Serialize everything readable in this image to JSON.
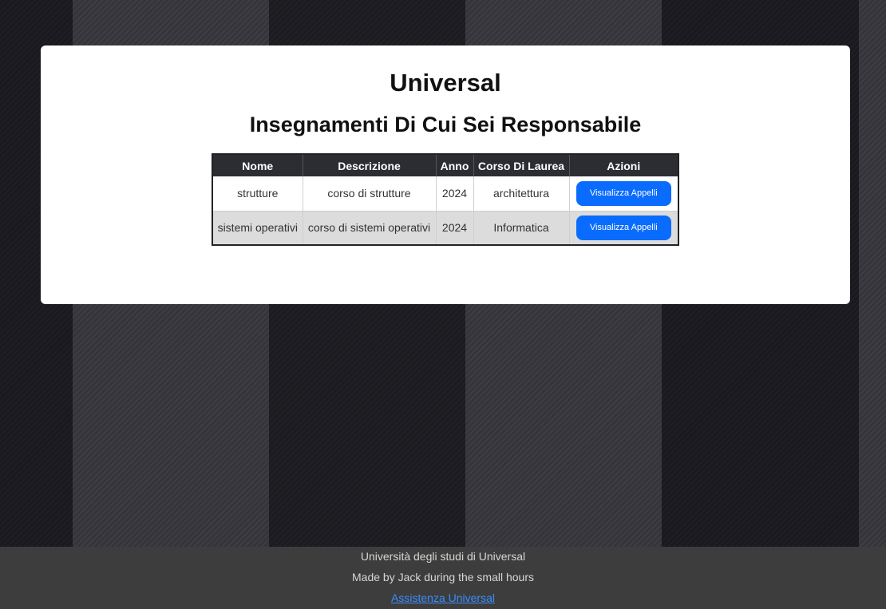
{
  "header": {
    "brand": "Universal",
    "subtitle": "Insegnamenti Di Cui Sei Responsabile"
  },
  "table": {
    "columns": [
      "Nome",
      "Descrizione",
      "Anno",
      "Corso Di Laurea",
      "Azioni"
    ],
    "rows": [
      {
        "nome": "strutture",
        "descrizione": "corso di strutture",
        "anno": "2024",
        "corso": "architettura",
        "azione": "Visualizza Appelli"
      },
      {
        "nome": "sistemi operativi",
        "descrizione": "corso di sistemi operativi",
        "anno": "2024",
        "corso": "Informatica",
        "azione": "Visualizza Appelli"
      }
    ]
  },
  "footer": {
    "university": "Università degli studi di Universal",
    "credit": "Made by Jack during the small hours",
    "support_link": "Assistenza Universal"
  },
  "colors": {
    "button": "#0a6cff",
    "table_header": "#2c2c33",
    "footer_bg": "#3d3d3d",
    "link": "#3a8cff"
  }
}
